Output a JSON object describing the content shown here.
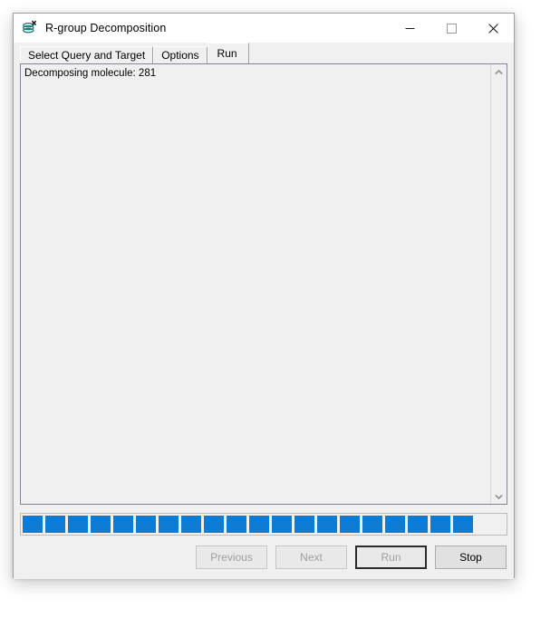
{
  "window": {
    "title": "R-group Decomposition",
    "icon": "stacked-disk-x-icon",
    "controls": {
      "minimize_label": "─",
      "maximize_label": "□",
      "close_label": "✕"
    }
  },
  "tabs": [
    {
      "label": "Select Query and Target",
      "active": false
    },
    {
      "label": "Options",
      "active": false
    },
    {
      "label": "Run",
      "active": true
    }
  ],
  "log": {
    "text": "Decomposing molecule: 281"
  },
  "scrollbar": {
    "up_arrow": "▲",
    "down_arrow": "▼"
  },
  "progress": {
    "segments_filled": 20,
    "segment_color": "#0c7cd5",
    "track_color": "#f0f0f0"
  },
  "buttons": [
    {
      "label": "Previous",
      "disabled": true,
      "default": false
    },
    {
      "label": "Next",
      "disabled": true,
      "default": false
    },
    {
      "label": "Run",
      "disabled": true,
      "default": true
    },
    {
      "label": "Stop",
      "disabled": false,
      "default": false
    }
  ],
  "colors": {
    "accent": "#0c7cd5",
    "window_bg": "#f0f0f0",
    "titlebar_bg": "#ffffff",
    "icon_teal": "#1f7a7a"
  }
}
